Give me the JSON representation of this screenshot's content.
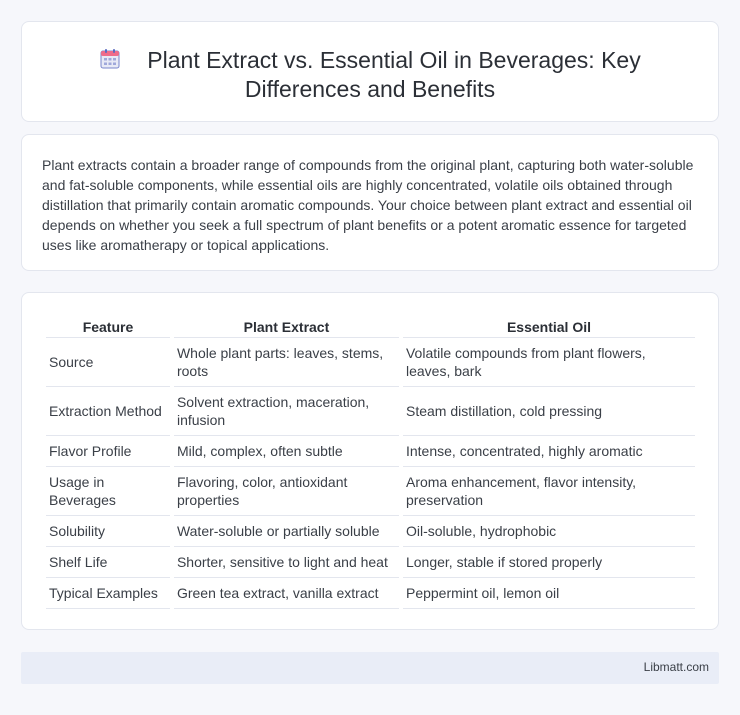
{
  "header": {
    "icon": "calendar-icon",
    "title": "Plant Extract vs. Essential Oil in Beverages: Key Differences and Benefits"
  },
  "summary": {
    "text": "Plant extracts contain a broader range of compounds from the original plant, capturing both water-soluble and fat-soluble components, while essential oils are highly concentrated, volatile oils obtained through distillation that primarily contain aromatic compounds. Your choice between plant extract and essential oil depends on whether you seek a full spectrum of plant benefits or a potent aromatic essence for targeted uses like aromatherapy or topical applications."
  },
  "table": {
    "headers": [
      "Feature",
      "Plant Extract",
      "Essential Oil"
    ],
    "rows": [
      [
        "Source",
        "Whole plant parts: leaves, stems, roots",
        "Volatile compounds from plant flowers, leaves, bark"
      ],
      [
        "Extraction Method",
        "Solvent extraction, maceration, infusion",
        "Steam distillation, cold pressing"
      ],
      [
        "Flavor Profile",
        "Mild, complex, often subtle",
        "Intense, concentrated, highly aromatic"
      ],
      [
        "Usage in Beverages",
        "Flavoring, color, antioxidant properties",
        "Aroma enhancement, flavor intensity, preservation"
      ],
      [
        "Solubility",
        "Water-soluble or partially soluble",
        "Oil-soluble, hydrophobic"
      ],
      [
        "Shelf Life",
        "Shorter, sensitive to light and heat",
        "Longer, stable if stored properly"
      ],
      [
        "Typical Examples",
        "Green tea extract, vanilla extract",
        "Peppermint oil, lemon oil"
      ]
    ]
  },
  "footer": {
    "brand": "Libmatt.com"
  }
}
